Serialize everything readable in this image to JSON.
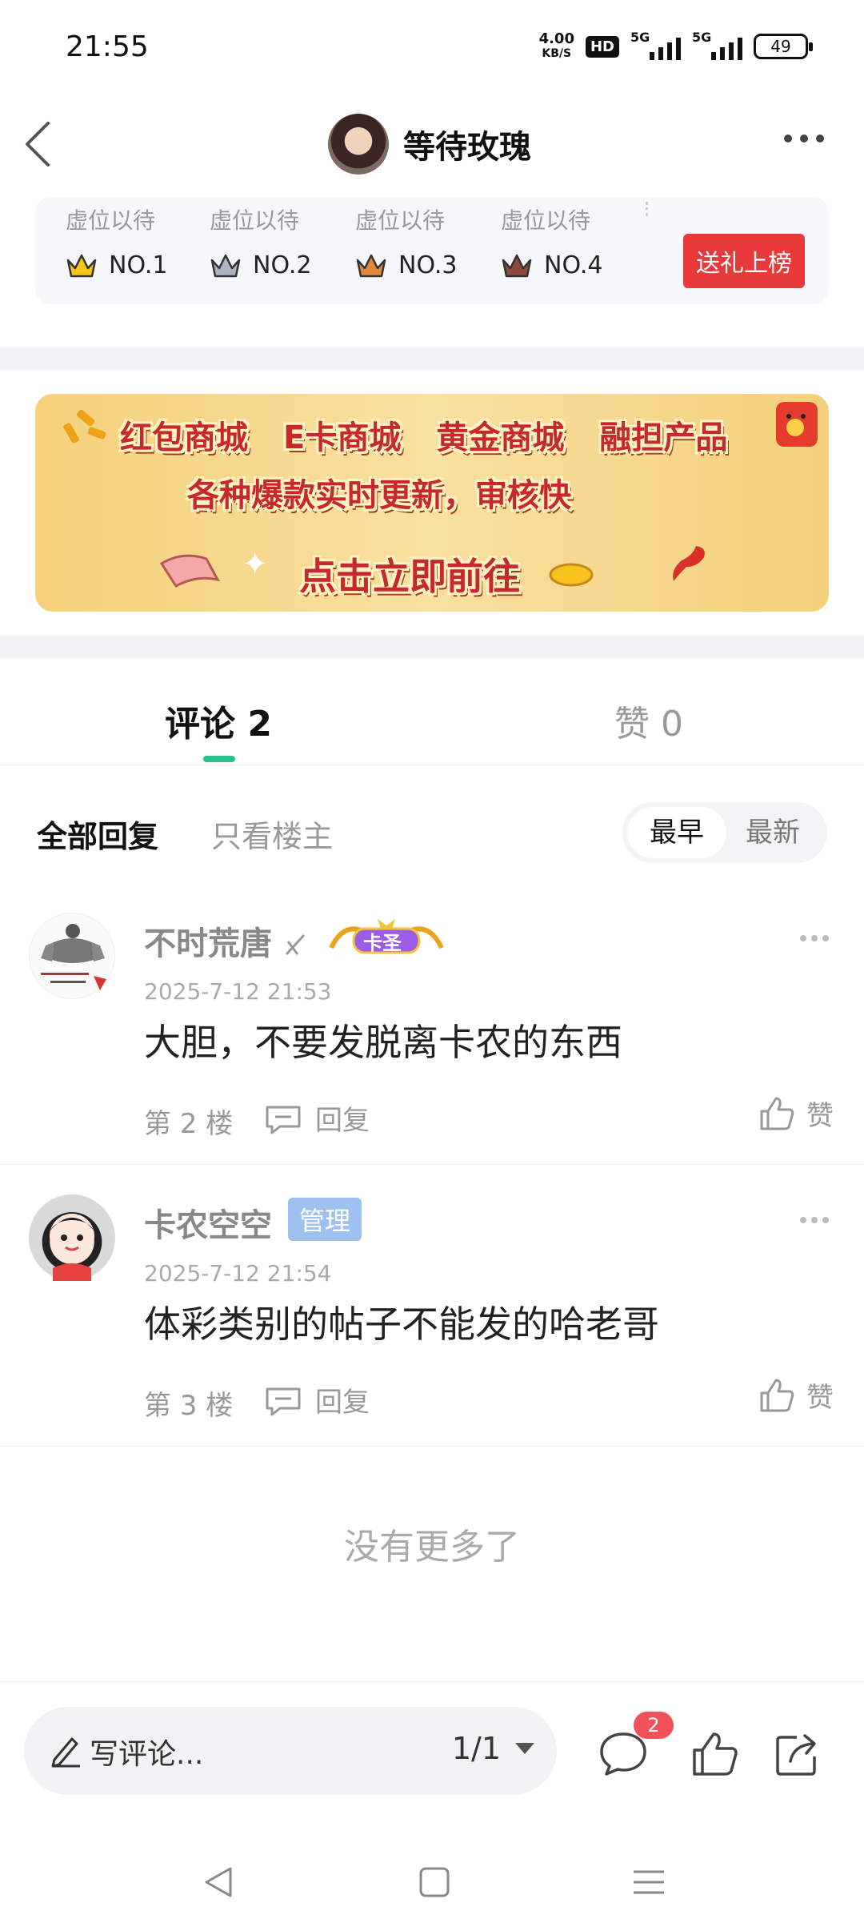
{
  "status_bar": {
    "time": "21:55",
    "net_speed": "4.00",
    "net_speed_unit": "KB/S",
    "hd_label": "HD",
    "signal1_label": "5G",
    "signal2_label": "5G",
    "battery": "49"
  },
  "nav": {
    "title": "等待玫瑰",
    "back_icon": "chevron-left-icon",
    "more_icon": "more-horizontal-icon"
  },
  "ranking": {
    "slots": [
      {
        "placeholder": "虚位以待",
        "rank": "NO.1",
        "crown_color": "#f5c518"
      },
      {
        "placeholder": "虚位以待",
        "rank": "NO.2",
        "crown_color": "#aab4c4"
      },
      {
        "placeholder": "虚位以待",
        "rank": "NO.3",
        "crown_color": "#e08a3a"
      },
      {
        "placeholder": "虚位以待",
        "rank": "NO.4",
        "crown_color": "#8b4a3a"
      }
    ],
    "gift_button": "送礼上榜"
  },
  "banner": {
    "links": [
      "红包商城",
      "E卡商城",
      "黄金商城",
      "融担产品"
    ],
    "subtitle": "各种爆款实时更新，审核快",
    "cta": "点击立即前往"
  },
  "tabs": {
    "comments": "评论 2",
    "likes": "赞 0",
    "active_color": "#2cc08f"
  },
  "filter": {
    "all": "全部回复",
    "owner_only": "只看楼主",
    "sort_earliest": "最早",
    "sort_newest": "最新"
  },
  "comments": [
    {
      "name": "不时荒唐",
      "badge": "卡圣",
      "time": "2025-7-12 21:53",
      "text": "大胆，不要发脱离卡农的东西",
      "floor": "第 2 楼",
      "reply": "回复",
      "like": "赞"
    },
    {
      "name": "卡农空空",
      "badge": "管理",
      "time": "2025-7-12 21:54",
      "text": "体彩类别的帖子不能发的哈老哥",
      "floor": "第 3 楼",
      "reply": "回复",
      "like": "赞"
    }
  ],
  "footer": {
    "no_more": "没有更多了"
  },
  "bottom_bar": {
    "write_placeholder": "写评论...",
    "page": "1/1",
    "comment_count": "2"
  }
}
